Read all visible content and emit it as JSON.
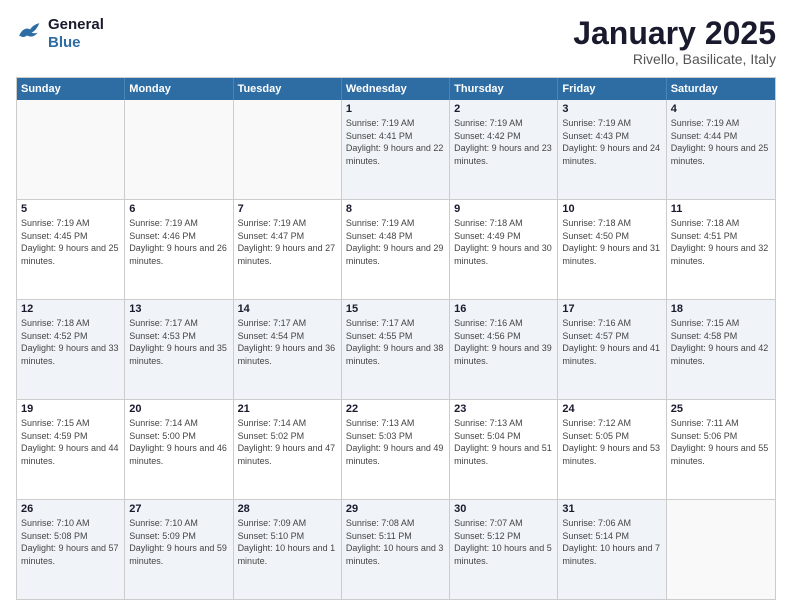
{
  "header": {
    "logo_line1": "General",
    "logo_line2": "Blue",
    "title": "January 2025",
    "subtitle": "Rivello, Basilicate, Italy"
  },
  "weekdays": [
    "Sunday",
    "Monday",
    "Tuesday",
    "Wednesday",
    "Thursday",
    "Friday",
    "Saturday"
  ],
  "weeks": [
    [
      {
        "day": "",
        "sunrise": "",
        "sunset": "",
        "daylight": "",
        "empty": true
      },
      {
        "day": "",
        "sunrise": "",
        "sunset": "",
        "daylight": "",
        "empty": true
      },
      {
        "day": "",
        "sunrise": "",
        "sunset": "",
        "daylight": "",
        "empty": true
      },
      {
        "day": "1",
        "sunrise": "Sunrise: 7:19 AM",
        "sunset": "Sunset: 4:41 PM",
        "daylight": "Daylight: 9 hours and 22 minutes."
      },
      {
        "day": "2",
        "sunrise": "Sunrise: 7:19 AM",
        "sunset": "Sunset: 4:42 PM",
        "daylight": "Daylight: 9 hours and 23 minutes."
      },
      {
        "day": "3",
        "sunrise": "Sunrise: 7:19 AM",
        "sunset": "Sunset: 4:43 PM",
        "daylight": "Daylight: 9 hours and 24 minutes."
      },
      {
        "day": "4",
        "sunrise": "Sunrise: 7:19 AM",
        "sunset": "Sunset: 4:44 PM",
        "daylight": "Daylight: 9 hours and 25 minutes."
      }
    ],
    [
      {
        "day": "5",
        "sunrise": "Sunrise: 7:19 AM",
        "sunset": "Sunset: 4:45 PM",
        "daylight": "Daylight: 9 hours and 25 minutes."
      },
      {
        "day": "6",
        "sunrise": "Sunrise: 7:19 AM",
        "sunset": "Sunset: 4:46 PM",
        "daylight": "Daylight: 9 hours and 26 minutes."
      },
      {
        "day": "7",
        "sunrise": "Sunrise: 7:19 AM",
        "sunset": "Sunset: 4:47 PM",
        "daylight": "Daylight: 9 hours and 27 minutes."
      },
      {
        "day": "8",
        "sunrise": "Sunrise: 7:19 AM",
        "sunset": "Sunset: 4:48 PM",
        "daylight": "Daylight: 9 hours and 29 minutes."
      },
      {
        "day": "9",
        "sunrise": "Sunrise: 7:18 AM",
        "sunset": "Sunset: 4:49 PM",
        "daylight": "Daylight: 9 hours and 30 minutes."
      },
      {
        "day": "10",
        "sunrise": "Sunrise: 7:18 AM",
        "sunset": "Sunset: 4:50 PM",
        "daylight": "Daylight: 9 hours and 31 minutes."
      },
      {
        "day": "11",
        "sunrise": "Sunrise: 7:18 AM",
        "sunset": "Sunset: 4:51 PM",
        "daylight": "Daylight: 9 hours and 32 minutes."
      }
    ],
    [
      {
        "day": "12",
        "sunrise": "Sunrise: 7:18 AM",
        "sunset": "Sunset: 4:52 PM",
        "daylight": "Daylight: 9 hours and 33 minutes."
      },
      {
        "day": "13",
        "sunrise": "Sunrise: 7:17 AM",
        "sunset": "Sunset: 4:53 PM",
        "daylight": "Daylight: 9 hours and 35 minutes."
      },
      {
        "day": "14",
        "sunrise": "Sunrise: 7:17 AM",
        "sunset": "Sunset: 4:54 PM",
        "daylight": "Daylight: 9 hours and 36 minutes."
      },
      {
        "day": "15",
        "sunrise": "Sunrise: 7:17 AM",
        "sunset": "Sunset: 4:55 PM",
        "daylight": "Daylight: 9 hours and 38 minutes."
      },
      {
        "day": "16",
        "sunrise": "Sunrise: 7:16 AM",
        "sunset": "Sunset: 4:56 PM",
        "daylight": "Daylight: 9 hours and 39 minutes."
      },
      {
        "day": "17",
        "sunrise": "Sunrise: 7:16 AM",
        "sunset": "Sunset: 4:57 PM",
        "daylight": "Daylight: 9 hours and 41 minutes."
      },
      {
        "day": "18",
        "sunrise": "Sunrise: 7:15 AM",
        "sunset": "Sunset: 4:58 PM",
        "daylight": "Daylight: 9 hours and 42 minutes."
      }
    ],
    [
      {
        "day": "19",
        "sunrise": "Sunrise: 7:15 AM",
        "sunset": "Sunset: 4:59 PM",
        "daylight": "Daylight: 9 hours and 44 minutes."
      },
      {
        "day": "20",
        "sunrise": "Sunrise: 7:14 AM",
        "sunset": "Sunset: 5:00 PM",
        "daylight": "Daylight: 9 hours and 46 minutes."
      },
      {
        "day": "21",
        "sunrise": "Sunrise: 7:14 AM",
        "sunset": "Sunset: 5:02 PM",
        "daylight": "Daylight: 9 hours and 47 minutes."
      },
      {
        "day": "22",
        "sunrise": "Sunrise: 7:13 AM",
        "sunset": "Sunset: 5:03 PM",
        "daylight": "Daylight: 9 hours and 49 minutes."
      },
      {
        "day": "23",
        "sunrise": "Sunrise: 7:13 AM",
        "sunset": "Sunset: 5:04 PM",
        "daylight": "Daylight: 9 hours and 51 minutes."
      },
      {
        "day": "24",
        "sunrise": "Sunrise: 7:12 AM",
        "sunset": "Sunset: 5:05 PM",
        "daylight": "Daylight: 9 hours and 53 minutes."
      },
      {
        "day": "25",
        "sunrise": "Sunrise: 7:11 AM",
        "sunset": "Sunset: 5:06 PM",
        "daylight": "Daylight: 9 hours and 55 minutes."
      }
    ],
    [
      {
        "day": "26",
        "sunrise": "Sunrise: 7:10 AM",
        "sunset": "Sunset: 5:08 PM",
        "daylight": "Daylight: 9 hours and 57 minutes."
      },
      {
        "day": "27",
        "sunrise": "Sunrise: 7:10 AM",
        "sunset": "Sunset: 5:09 PM",
        "daylight": "Daylight: 9 hours and 59 minutes."
      },
      {
        "day": "28",
        "sunrise": "Sunrise: 7:09 AM",
        "sunset": "Sunset: 5:10 PM",
        "daylight": "Daylight: 10 hours and 1 minute."
      },
      {
        "day": "29",
        "sunrise": "Sunrise: 7:08 AM",
        "sunset": "Sunset: 5:11 PM",
        "daylight": "Daylight: 10 hours and 3 minutes."
      },
      {
        "day": "30",
        "sunrise": "Sunrise: 7:07 AM",
        "sunset": "Sunset: 5:12 PM",
        "daylight": "Daylight: 10 hours and 5 minutes."
      },
      {
        "day": "31",
        "sunrise": "Sunrise: 7:06 AM",
        "sunset": "Sunset: 5:14 PM",
        "daylight": "Daylight: 10 hours and 7 minutes."
      },
      {
        "day": "",
        "sunrise": "",
        "sunset": "",
        "daylight": "",
        "empty": true
      }
    ]
  ]
}
